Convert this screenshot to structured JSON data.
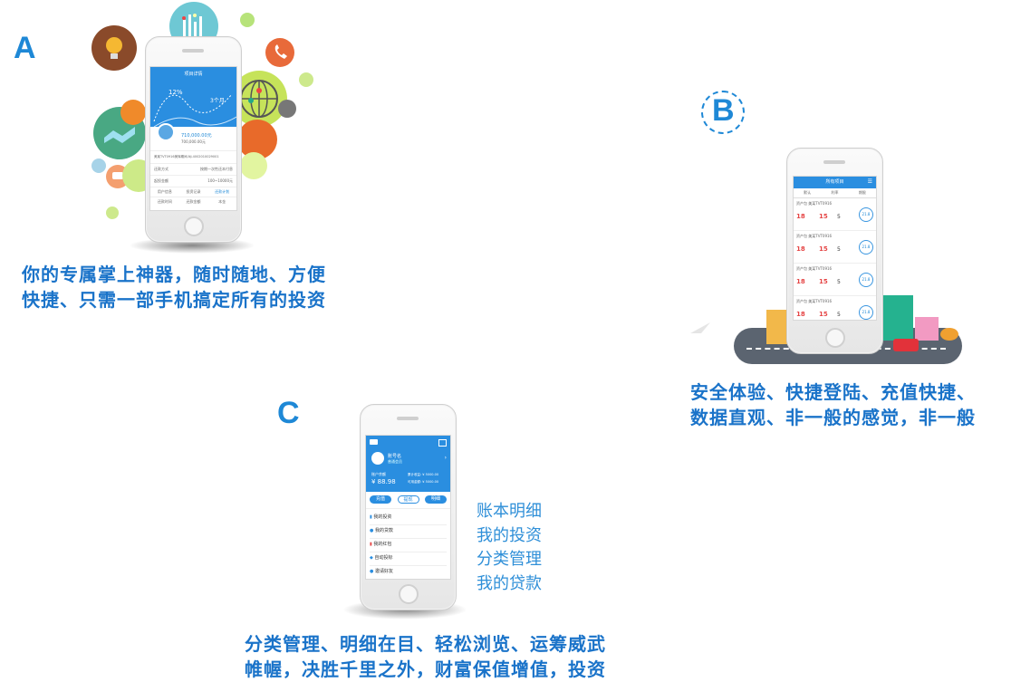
{
  "section_a": {
    "letter": "A",
    "caption_line1": "你的专属掌上神器，随时随地、方便",
    "caption_line2": "快捷、只需一部手机搞定所有的投资",
    "screen_title": "项目详情",
    "rate": "12%",
    "months": "3个月",
    "amount": "710,000.00元",
    "remain": "700,000.00元",
    "code_line": "美某TVT0916美辉期间-NJ-4002010029001",
    "repay_label": "还款方式",
    "repay_value": "按期一次性还本付息",
    "start_label": "起投金额",
    "start_value": "100~10000元",
    "tabs": [
      "用户信息",
      "投资记录",
      "还款计划"
    ],
    "row2": [
      "还款时间",
      "还款金额",
      "本金"
    ],
    "colors": {
      "accent": "#1e88d6"
    }
  },
  "section_b": {
    "letter": "B",
    "caption_line1": "安全体验、快捷登陆、充值快捷、",
    "caption_line2": "数据直观、非一般的感觉，非一般",
    "screen_title": "所有项目",
    "sort": [
      "默认",
      "利率",
      "期限"
    ],
    "items": [
      {
        "label": "资产包  美某TVT0916",
        "rate": "18",
        "rate2": "15",
        "term": "5",
        "progress": "21.8"
      },
      {
        "label": "资产包  美某TVT0916",
        "rate": "18",
        "rate2": "15",
        "term": "5",
        "progress": "21.8"
      },
      {
        "label": "资产包  美某TVT0916",
        "rate": "18",
        "rate2": "15",
        "term": "5",
        "progress": "21.8"
      },
      {
        "label": "资产包  美某TVT0916",
        "rate": "18",
        "rate2": "15",
        "term": "5",
        "progress": "21.8"
      }
    ]
  },
  "section_c": {
    "letter": "C",
    "caption_line1": "分类管理、明细在目、轻松浏览、运筹威武",
    "caption_line2": "帷幄，决胜千里之外，财富保值增值，投资",
    "username": "账号名",
    "user_sub": "普通会员",
    "balance_label": "账户余额",
    "balance": "¥ 88.98",
    "stat1": "累计收益: ¥ 5000.00",
    "stat2": "可用金额: ¥ 5000.00",
    "buttons": [
      "充值",
      "提现",
      "明细"
    ],
    "menu": [
      "我的投资",
      "我的贷款",
      "我的红包",
      "自动投标",
      "邀请好友"
    ],
    "features": [
      "账本明细",
      "我的投资",
      "分类管理",
      "我的贷款"
    ]
  }
}
